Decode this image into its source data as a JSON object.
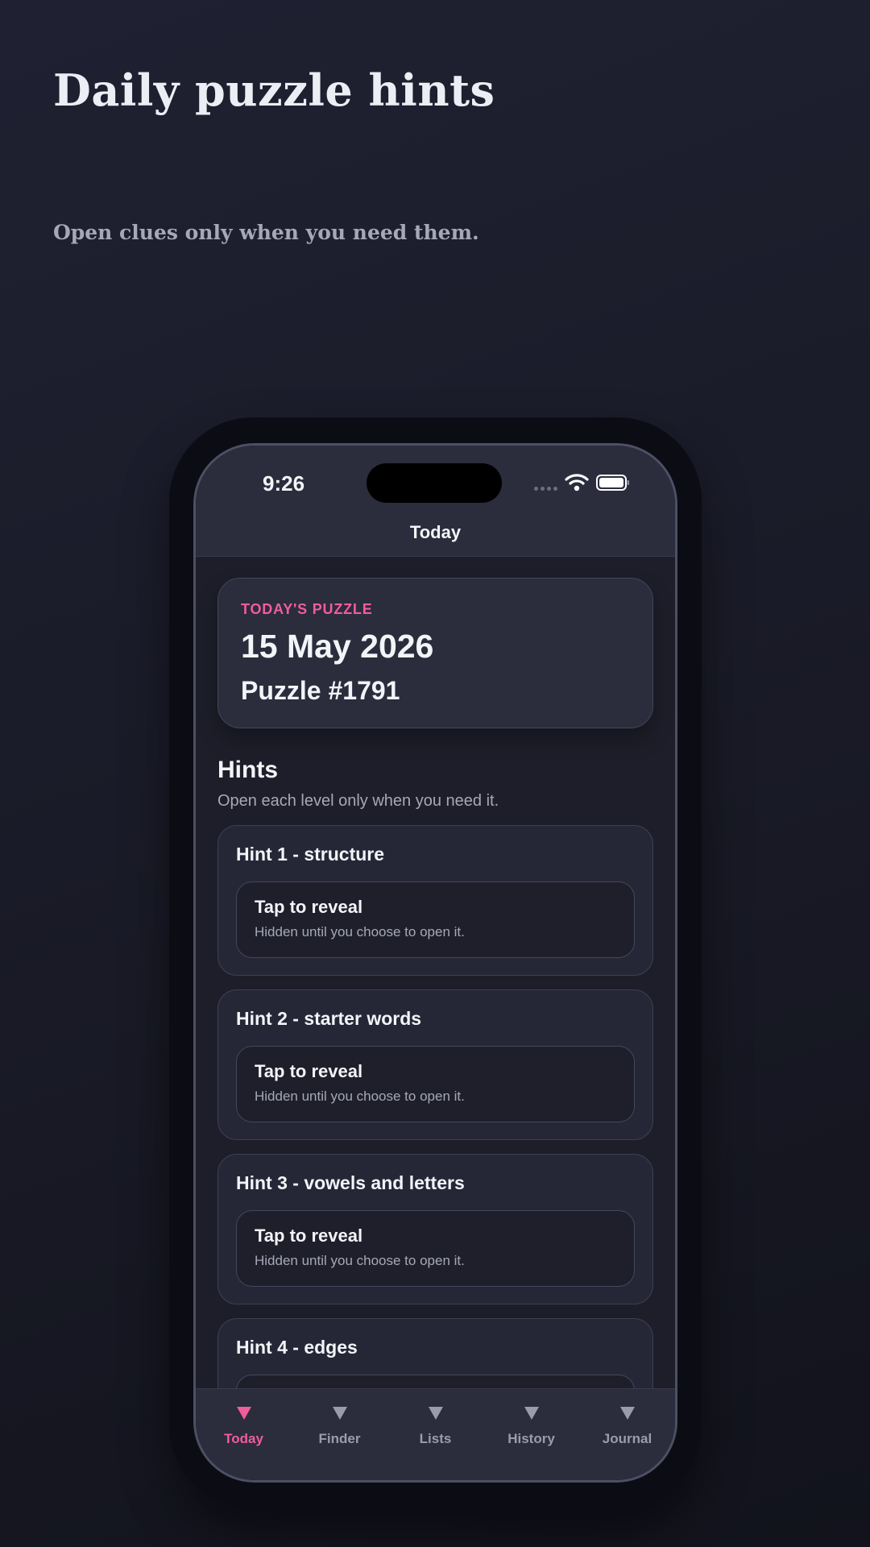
{
  "hero": {
    "title": "Daily puzzle hints",
    "subtitle": "Open clues only when you need them."
  },
  "status_bar": {
    "time": "9:26",
    "icons": [
      "signal-dots-icon",
      "wifi-icon",
      "battery-icon"
    ]
  },
  "nav": {
    "title": "Today"
  },
  "puzzle": {
    "kicker": "TODAY'S PUZZLE",
    "date": "15 May 2026",
    "number": "Puzzle #1791"
  },
  "hints": {
    "heading": "Hints",
    "subheading": "Open each level only when you need it.",
    "items": [
      {
        "title": "Hint 1 - structure",
        "reveal_label": "Tap to reveal",
        "reveal_desc": "Hidden until you choose to open it."
      },
      {
        "title": "Hint 2 - starter words",
        "reveal_label": "Tap to reveal",
        "reveal_desc": "Hidden until you choose to open it."
      },
      {
        "title": "Hint 3 - vowels and letters",
        "reveal_label": "Tap to reveal",
        "reveal_desc": "Hidden until you choose to open it."
      },
      {
        "title": "Hint 4 - edges"
      }
    ]
  },
  "tabs": [
    {
      "label": "Today",
      "active": true
    },
    {
      "label": "Finder",
      "active": false
    },
    {
      "label": "Lists",
      "active": false
    },
    {
      "label": "History",
      "active": false
    },
    {
      "label": "Journal",
      "active": false
    }
  ],
  "colors": {
    "accent": "#f05d9a",
    "background": "#1d1e29",
    "card": "#2b2c3c",
    "muted_text": "#a6a8b8"
  }
}
